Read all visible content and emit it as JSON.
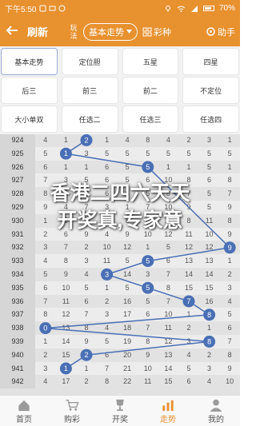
{
  "status": {
    "time": "下午5:50",
    "battery": "70%"
  },
  "header": {
    "back_icon": "arrow-left-icon",
    "refresh": "刷新",
    "wanfa": "玩法",
    "mode": "基本走势",
    "colors": "彩种",
    "helper": "助手"
  },
  "menu": {
    "options": [
      "基本走势",
      "定位胆",
      "五星",
      "四星",
      "后三",
      "前三",
      "前二",
      "不定位",
      "大小单双",
      "任选二",
      "任选三",
      "任选四"
    ],
    "selected": 0
  },
  "trend": {
    "rows": [
      {
        "issue": "924",
        "cells": [
          "4",
          "1",
          "2",
          "1",
          "4",
          "8",
          "4",
          "2",
          "3",
          "1"
        ]
      },
      {
        "issue": "925",
        "cells": [
          "5",
          "1",
          "3",
          "5",
          "5",
          "5",
          "5",
          "5",
          "5",
          "5"
        ]
      },
      {
        "issue": "926",
        "cells": [
          "6",
          "1",
          "1",
          "6",
          "5",
          "1",
          "1",
          "1",
          "5",
          "1"
        ]
      },
      {
        "issue": "927",
        "cells": [
          "7",
          "3",
          "5",
          "6",
          "5",
          "6",
          "10",
          "8",
          "6",
          "8"
        ]
      },
      {
        "issue": "928",
        "cells": [
          "8",
          "3",
          "2",
          "6",
          "5",
          "5",
          "8",
          "7",
          "5",
          "7"
        ]
      },
      {
        "issue": "929",
        "cells": [
          "9",
          "4",
          "7",
          "3",
          "1",
          "7",
          "10",
          "9",
          "5",
          "9"
        ]
      },
      {
        "issue": "930",
        "cells": [
          "1",
          "5",
          "5",
          "4",
          "8",
          "8",
          "11",
          "8",
          "11",
          "8"
        ]
      },
      {
        "issue": "931",
        "cells": [
          "2",
          "6",
          "9",
          "4",
          "9",
          "10",
          "12",
          "11",
          "10",
          "9"
        ]
      },
      {
        "issue": "932",
        "cells": [
          "3",
          "7",
          "2",
          "10",
          "12",
          "1",
          "5",
          "12",
          "12",
          "9"
        ]
      },
      {
        "issue": "933",
        "cells": [
          "4",
          "8",
          "3",
          "11",
          "5",
          "2",
          "6",
          "13",
          "13",
          "1"
        ]
      },
      {
        "issue": "934",
        "cells": [
          "5",
          "9",
          "4",
          "3",
          "14",
          "3",
          "7",
          "14",
          "14",
          "2"
        ]
      },
      {
        "issue": "935",
        "cells": [
          "6",
          "10",
          "5",
          "1",
          "5",
          "4",
          "8",
          "15",
          "15",
          "3"
        ]
      },
      {
        "issue": "936",
        "cells": [
          "7",
          "11",
          "6",
          "2",
          "16",
          "5",
          "7",
          "16",
          "16",
          "4"
        ]
      },
      {
        "issue": "937",
        "cells": [
          "8",
          "12",
          "7",
          "3",
          "17",
          "6",
          "10",
          "1",
          "8",
          "5"
        ]
      },
      {
        "issue": "938",
        "cells": [
          "0",
          "13",
          "8",
          "4",
          "18",
          "7",
          "11",
          "2",
          "1",
          "6"
        ]
      },
      {
        "issue": "939",
        "cells": [
          "1",
          "14",
          "9",
          "5",
          "19",
          "8",
          "12",
          "3",
          "8",
          "7"
        ]
      },
      {
        "issue": "940",
        "cells": [
          "2",
          "15",
          "2",
          "6",
          "20",
          "9",
          "13",
          "4",
          "2",
          "8"
        ]
      },
      {
        "issue": "941",
        "cells": [
          "3",
          "16",
          "1",
          "7",
          "21",
          "10",
          "14",
          "5",
          "3",
          "9"
        ]
      },
      {
        "issue": "942",
        "cells": [
          "4",
          "17",
          "2",
          "8",
          "22",
          "11",
          "15",
          "6",
          "4",
          "10"
        ]
      }
    ],
    "balls": [
      {
        "row": 0,
        "col": 2,
        "value": "2"
      },
      {
        "row": 1,
        "col": 1,
        "value": "1"
      },
      {
        "row": 2,
        "col": 5,
        "value": "5"
      },
      {
        "row": 8,
        "col": 9,
        "value": "9"
      },
      {
        "row": 9,
        "col": 5,
        "value": "5"
      },
      {
        "row": 10,
        "col": 3,
        "value": "3"
      },
      {
        "row": 11,
        "col": 5,
        "value": "5"
      },
      {
        "row": 12,
        "col": 7,
        "value": "7"
      },
      {
        "row": 13,
        "col": 8,
        "value": "8"
      },
      {
        "row": 14,
        "col": 0,
        "value": "0"
      },
      {
        "row": 15,
        "col": 8,
        "value": "8"
      },
      {
        "row": 16,
        "col": 2,
        "value": "2"
      },
      {
        "row": 17,
        "col": 1,
        "value": "1"
      }
    ],
    "ball_color": "#4a6fb5"
  },
  "overlay": {
    "line1": "香港二四六天天",
    "line2": "开奖真,专家意"
  },
  "tabs": [
    {
      "label": "首页",
      "icon": "home-icon",
      "active": false
    },
    {
      "label": "购彩",
      "icon": "cart-icon",
      "active": false
    },
    {
      "label": "开奖",
      "icon": "trophy-icon",
      "active": false
    },
    {
      "label": "走势",
      "icon": "chart-icon",
      "active": true
    },
    {
      "label": "我的",
      "icon": "user-icon",
      "active": false
    }
  ],
  "colors": {
    "accent": "#e8912f",
    "ball": "#4a6fb5"
  }
}
